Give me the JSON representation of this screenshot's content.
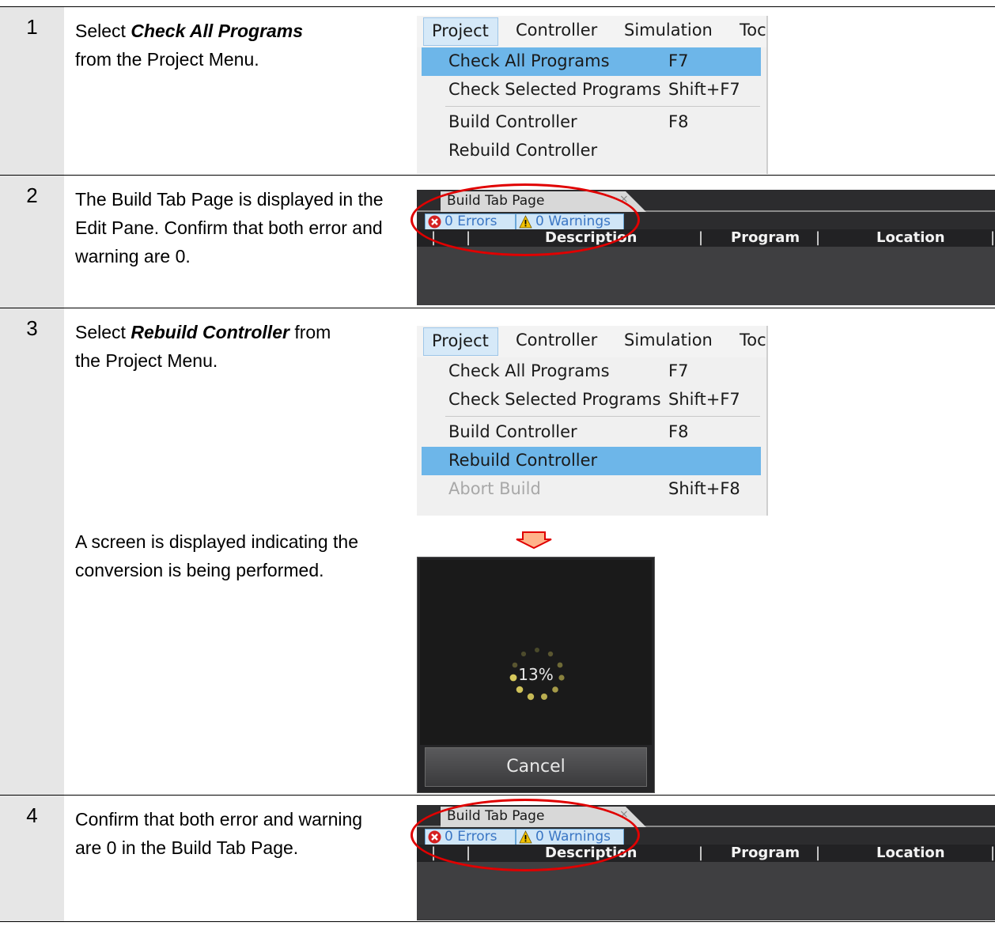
{
  "steps": [
    {
      "num": "1",
      "pre": "Select ",
      "bold": "Check All Programs",
      "post": "from the Project Menu."
    },
    {
      "num": "2",
      "text": "The Build Tab Page is displayed in the Edit Pane. Confirm that both error and warning are 0."
    },
    {
      "num": "3",
      "pre": "Select ",
      "bold": "Rebuild Controller",
      "post_inline": " from",
      "post": "the Project Menu.",
      "text2": "A screen is displayed indicating the conversion is being performed."
    },
    {
      "num": "4",
      "text": "Confirm that both error and warning are 0 in the Build Tab Page."
    }
  ],
  "menu": {
    "bar": [
      "Project",
      "Controller",
      "Simulation",
      "Toc"
    ],
    "items": [
      {
        "label": "Check All Programs",
        "shortcut": "F7"
      },
      {
        "label": "Check Selected Programs",
        "shortcut": "Shift+F7"
      },
      {
        "label": "Build Controller",
        "shortcut": "F8"
      },
      {
        "label": "Rebuild Controller",
        "shortcut": ""
      },
      {
        "label": "Abort Build",
        "shortcut": "Shift+F8"
      }
    ]
  },
  "build_tab": {
    "tab_label": "Build Tab Page",
    "close_glyph": "×",
    "errors_label": "0  Errors",
    "warnings_label": "0  Warnings",
    "columns": [
      "Description",
      "Program",
      "Location"
    ]
  },
  "progress": {
    "percent": "13%",
    "cancel_label": "Cancel"
  },
  "colors": {
    "highlight": "#6db6e9",
    "ellipse": "#e00000",
    "arrow": "#ffb38a"
  }
}
